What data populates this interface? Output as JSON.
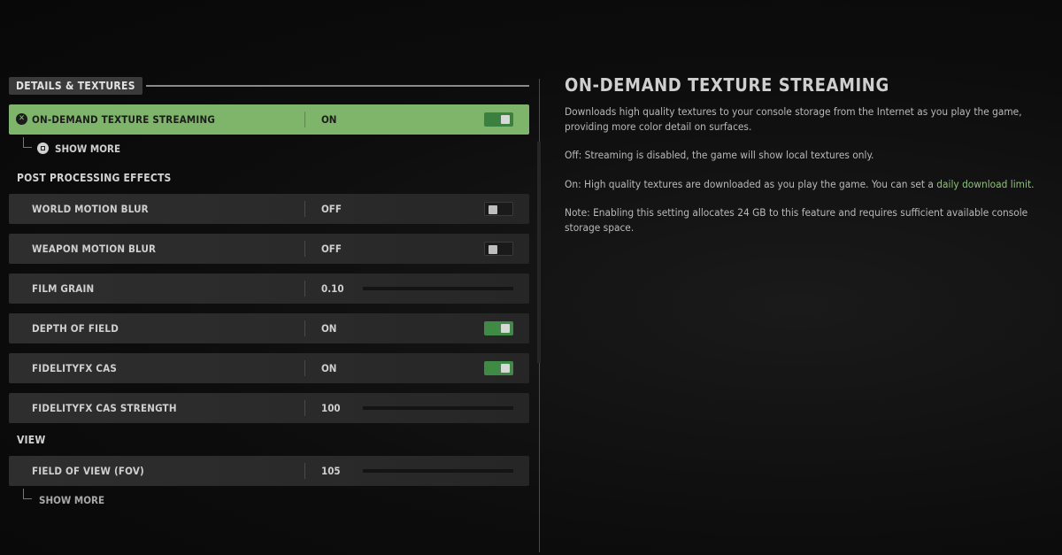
{
  "sections": {
    "details_textures": "DETAILS & TEXTURES",
    "post_processing": "POST PROCESSING EFFECTS",
    "view": "VIEW"
  },
  "settings": {
    "texture_streaming": {
      "label": "ON-DEMAND TEXTURE STREAMING",
      "value": "ON",
      "state": "on"
    },
    "show_more_1": "SHOW MORE",
    "world_motion_blur": {
      "label": "WORLD MOTION BLUR",
      "value": "OFF",
      "state": "off"
    },
    "weapon_motion_blur": {
      "label": "WEAPON MOTION BLUR",
      "value": "OFF",
      "state": "off"
    },
    "film_grain": {
      "label": "FILM GRAIN",
      "value": "0.10",
      "level": 0.1
    },
    "depth_of_field": {
      "label": "DEPTH OF FIELD",
      "value": "ON",
      "state": "on"
    },
    "fidelityfx_cas": {
      "label": "FIDELITYFX CAS",
      "value": "ON",
      "state": "on"
    },
    "cas_strength": {
      "label": "FIDELITYFX CAS STRENGTH",
      "value": "100",
      "level": 1.0
    },
    "fov": {
      "label": "FIELD OF VIEW (FOV)",
      "value": "105",
      "level": 0.76
    },
    "show_more_2": "SHOW MORE"
  },
  "detail": {
    "title": "ON-DEMAND TEXTURE STREAMING",
    "p1": "Downloads high quality textures to your console storage from the Internet as you play the game, providing more color detail on surfaces.",
    "p2": "Off: Streaming is disabled, the game will show local textures only.",
    "p3_prefix": "On: High quality textures are downloaded as you play the game. You can set a ",
    "p3_link": "daily download limit",
    "p3_suffix": ".",
    "p4": "Note: Enabling this setting allocates 24 GB to this feature and requires sufficient available console storage space."
  },
  "colors": {
    "active_row": "#7fb56a",
    "toggle_on": "#3f8a45",
    "link": "#8fc27a"
  },
  "icons": {
    "active_row": "x-button-icon",
    "show_more": "square-button-icon"
  }
}
